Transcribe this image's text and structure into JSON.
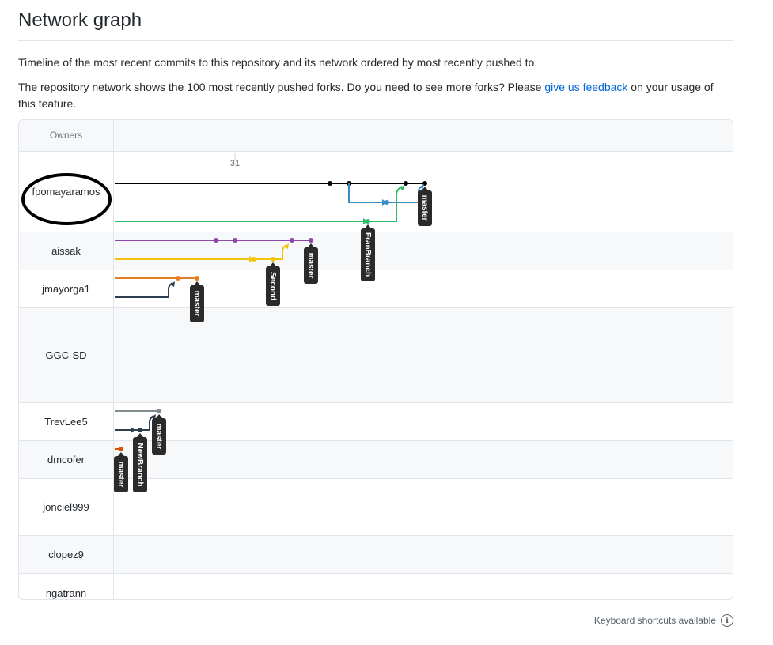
{
  "page": {
    "title": "Network graph",
    "description_1": "Timeline of the most recent commits to this repository and its network ordered by most recently pushed to.",
    "description_2_before": "The repository network shows the 100 most recently pushed forks. Do you need to see more forks? Please ",
    "description_2_link": "give us feedback",
    "description_2_after": " on your usage of this feature."
  },
  "graph": {
    "owners_header": "Owners",
    "date_tick": "31",
    "owners": [
      "fpomayaramos",
      "aissak",
      "jmayorga1",
      "GGC-SD",
      "TrevLee5",
      "dmcofer",
      "jonciel999",
      "clopez9",
      "ngatrann"
    ],
    "branch_labels": [
      "master",
      "FranBranch",
      "master",
      "Second",
      "master",
      "master",
      "NewBranch",
      "master"
    ],
    "colors": {
      "black": "#000000",
      "blue": "#3b8bc6",
      "green": "#2ebd6b",
      "purple": "#8e44ad",
      "yellow": "#f1c40f",
      "orange": "#e67e22",
      "navy": "#2c3e50",
      "gray": "#7f8c8d",
      "darkorange": "#d35400",
      "label_bg": "#2b2b2b"
    }
  },
  "footer": {
    "shortcuts": "Keyboard shortcuts available"
  }
}
